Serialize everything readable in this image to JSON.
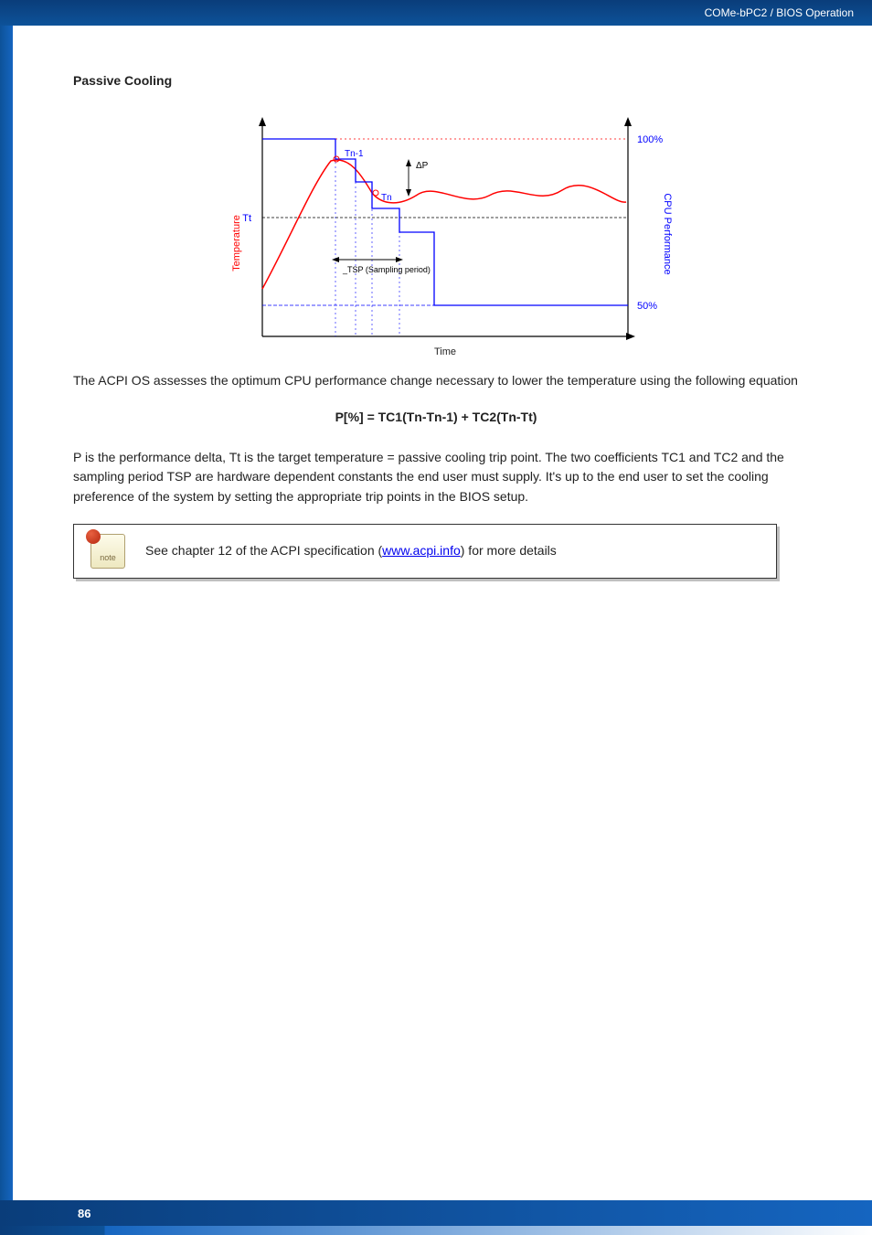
{
  "header": {
    "breadcrumb": "COMe-bPC2 / BIOS Operation"
  },
  "section": {
    "heading": "Passive Cooling"
  },
  "chart_data": {
    "type": "line",
    "title": "",
    "xlabel": "Time",
    "ylabel_left": "Temperature",
    "ylabel_right": "CPU Performance",
    "y_left_marks": [
      "Tt"
    ],
    "y_right_marks": [
      "100%",
      "50%"
    ],
    "annotations": {
      "delta_p": "ΔP",
      "tn": "Tn",
      "tn1": "Tn-1",
      "tsp": "_TSP (Sampling period)"
    },
    "series": [
      {
        "name": "Temperature",
        "color": "red",
        "x": [
          0,
          8,
          15,
          20,
          25,
          33,
          40,
          55,
          70,
          85,
          100
        ],
        "y": [
          30,
          52,
          68,
          78,
          82,
          74,
          70,
          77,
          70,
          74,
          68
        ]
      },
      {
        "name": "CPU Performance",
        "color": "blue",
        "x": [
          0,
          18,
          18,
          23,
          23,
          28,
          28,
          36,
          36,
          46,
          46,
          100
        ],
        "y": [
          100,
          100,
          92,
          92,
          82,
          82,
          70,
          70,
          62,
          62,
          50,
          50
        ]
      }
    ],
    "guides": {
      "trip_point_y": 82,
      "tsp_bracket_x": [
        15,
        33
      ]
    }
  },
  "body": {
    "para1": "The ACPI OS assesses the optimum CPU performance change necessary to lower the temperature using the following equation",
    "formula": "P[%] = TC1(Tn-Tn-1) + TC2(Tn-Tt)",
    "para2": "P is the performance delta, Tt is the target temperature = passive cooling trip point. The two coefficients TC1 and TC2 and the sampling period TSP are hardware dependent constants the end user must supply. It's up to the end user to set the cooling preference of the system by setting the appropriate trip points in the BIOS setup."
  },
  "note": {
    "icon_label": "note",
    "text_pre": "See chapter 12 of the ACPI specification (",
    "link_text": "www.acpi.info",
    "text_post": ") for more details"
  },
  "footer": {
    "page_number": "86"
  }
}
